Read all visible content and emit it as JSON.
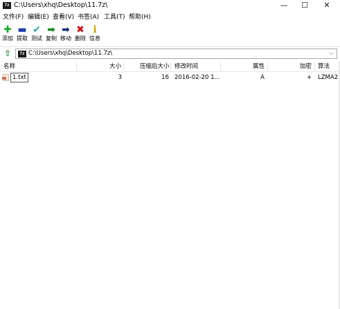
{
  "window": {
    "title": "C:\\Users\\xhq\\Desktop\\11.7z\\",
    "app_icon_text": "7z"
  },
  "window_controls": {
    "minimize": "—",
    "maximize": "☐",
    "close": "✕"
  },
  "menu": [
    "文件(F)",
    "编辑(E)",
    "查看(V)",
    "书签(A)",
    "工具(T)",
    "帮助(H)"
  ],
  "toolbar": [
    {
      "label": "添加",
      "glyph": "✚",
      "color": "#18a82a",
      "icon": "add-icon"
    },
    {
      "label": "提取",
      "glyph": "▬",
      "color": "#1f3fb0",
      "icon": "extract-icon"
    },
    {
      "label": "测试",
      "glyph": "✔",
      "color": "#25a7b5",
      "icon": "test-icon"
    },
    {
      "label": "复制",
      "glyph": "➡",
      "color": "#1a8a2a",
      "icon": "copy-icon"
    },
    {
      "label": "移动",
      "glyph": "➡",
      "color": "#1b2f7a",
      "icon": "move-icon"
    },
    {
      "label": "删除",
      "glyph": "✖",
      "color": "#d0141a",
      "icon": "delete-icon"
    },
    {
      "label": "信息",
      "glyph": "i",
      "color": "#c9a400",
      "icon": "info-icon"
    }
  ],
  "address": {
    "path": "C:\\Users\\xhq\\Desktop\\11.7z\\",
    "up_glyph": "⇧",
    "dropdown_glyph": "⌵"
  },
  "columns": [
    "名称",
    "大小",
    "压缩后大小",
    "修改时间",
    "属性",
    "加密",
    "算法"
  ],
  "rows": [
    {
      "name": "1.txt",
      "size": "3",
      "packed": "16",
      "modified": "2016-02-20 1...",
      "attr": "A",
      "encrypted": "+",
      "method": "LZMA2"
    }
  ]
}
